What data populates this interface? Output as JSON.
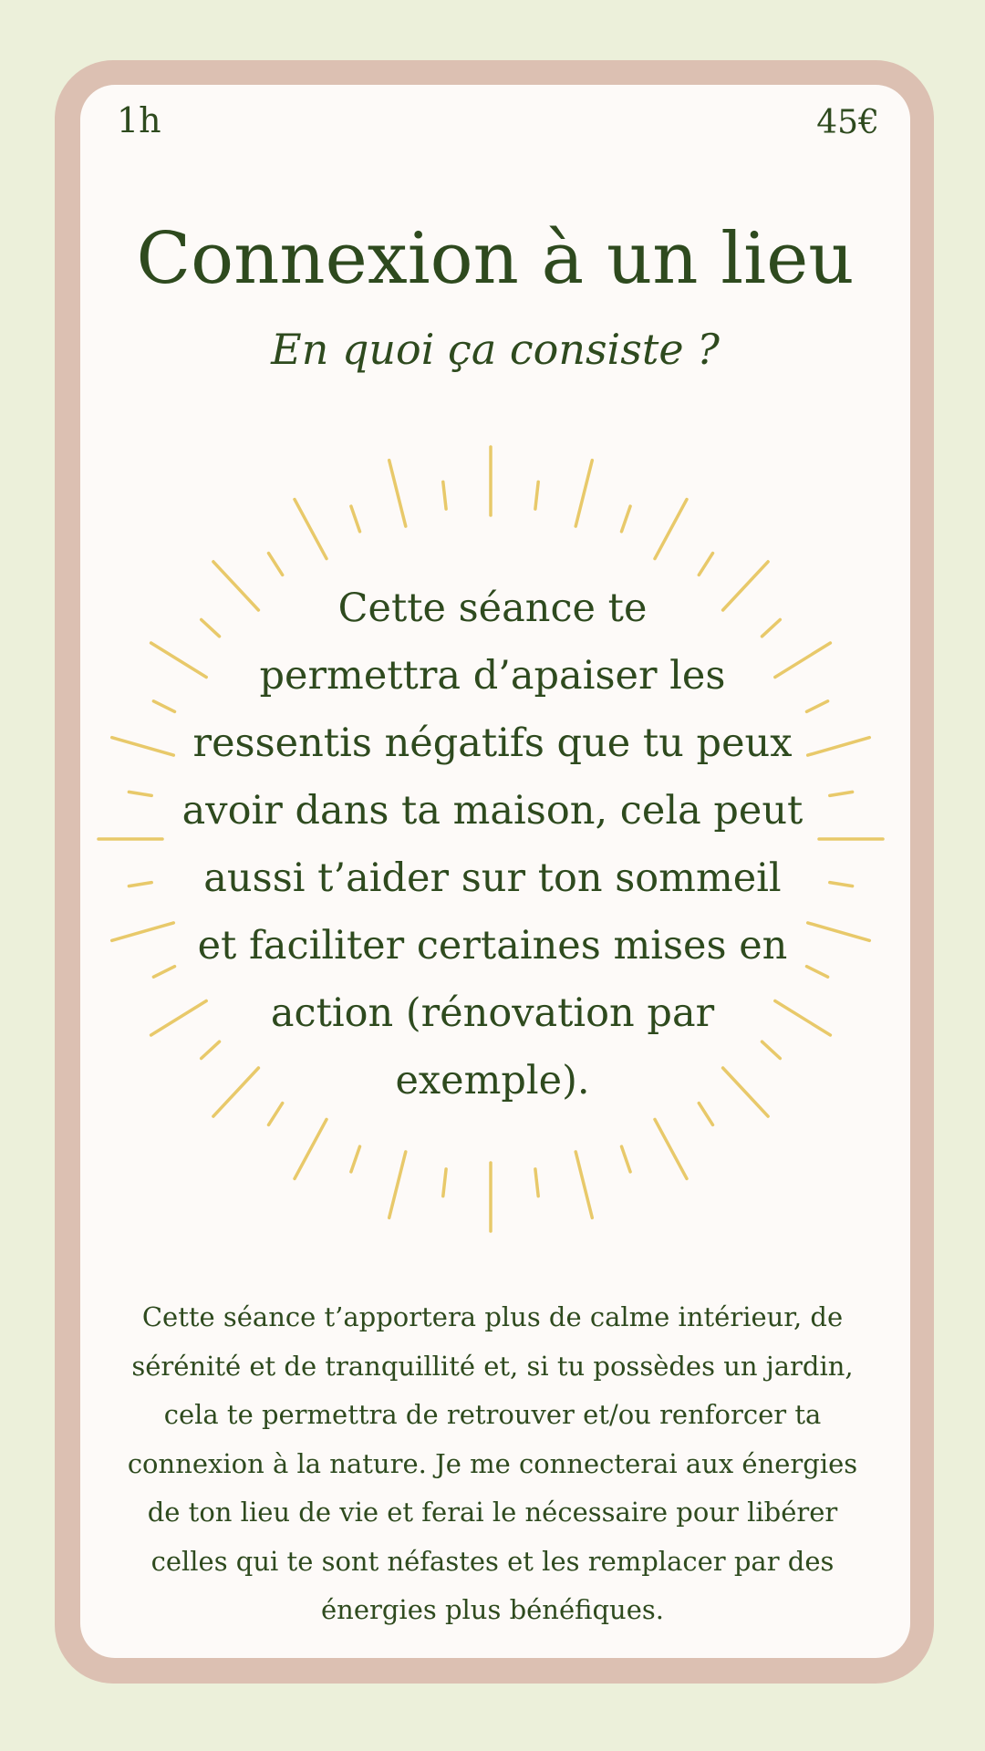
{
  "card": {
    "duration": "1h",
    "price": "45€",
    "title": "Connexion à un lieu",
    "subtitle": "En quoi ça consiste ?",
    "burst_color": "#e8c96a",
    "text_color": "#2e4a1e",
    "frame_color": "#dcc0b2",
    "background_color": "#ecf0da",
    "center_lines": [
      "Cette séance te",
      "permettra d’apaiser les",
      "ressentis négatifs que tu peux",
      "avoir dans ta maison, cela peut",
      "aussi t’aider sur ton sommeil",
      "et faciliter certaines mises en",
      "action (rénovation par",
      "exemple)."
    ],
    "bottom_lines": [
      "Cette séance t’apportera plus de calme intérieur, de",
      "sérénité et de tranquillité et, si tu possèdes un jardin,",
      "cela te permettra de retrouver et/ou renforcer ta",
      "connexion à la nature. Je me connecterai aux énergies",
      "de ton lieu de vie et ferai le nécessaire pour libérer",
      "celles qui te sont néfastes et les remplacer par des",
      "énergies plus bénéfiques."
    ]
  }
}
